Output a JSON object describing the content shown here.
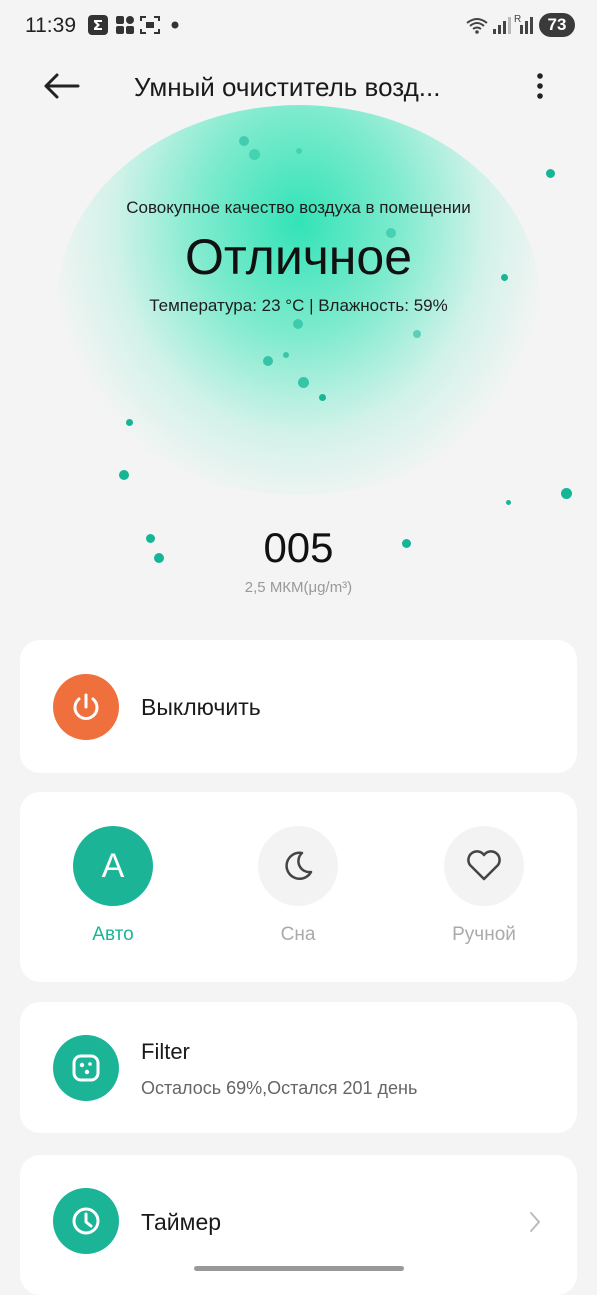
{
  "status_bar": {
    "time": "11:39",
    "network_badges": "R",
    "battery": "73"
  },
  "header": {
    "title": "Умный очиститель возд...",
    "back_icon": "back-arrow-icon",
    "more_icon": "more-vertical-icon"
  },
  "air_quality": {
    "subtitle": "Совокупное качество воздуха в помещении",
    "rating": "Отличное",
    "detail": "Температура: 23 °C | Влажность: 59%",
    "pm_value": "005",
    "pm_unit": "2,5 МКМ(μg/m³)"
  },
  "power_card": {
    "label": "Выключить",
    "icon": "power-icon",
    "color": "#f0703d"
  },
  "modes": {
    "items": [
      {
        "label": "Авто",
        "glyph": "A",
        "icon": "auto-mode-icon",
        "active": true
      },
      {
        "label": "Сна",
        "icon": "moon-icon",
        "active": false
      },
      {
        "label": "Ручной",
        "icon": "heart-icon",
        "active": false
      }
    ],
    "active_color": "#1bb497",
    "inactive_label_color": "#aaaaaa"
  },
  "filter_card": {
    "title": "Filter",
    "status": "Осталось 69%,Остался 201 день",
    "icon": "filter-icon"
  },
  "timer_card": {
    "label": "Таймер",
    "icon": "clock-icon",
    "chevron": "chevron-right-icon"
  },
  "colors": {
    "accent": "#1bb497",
    "background": "#f4f4f4",
    "card": "#ffffff"
  }
}
